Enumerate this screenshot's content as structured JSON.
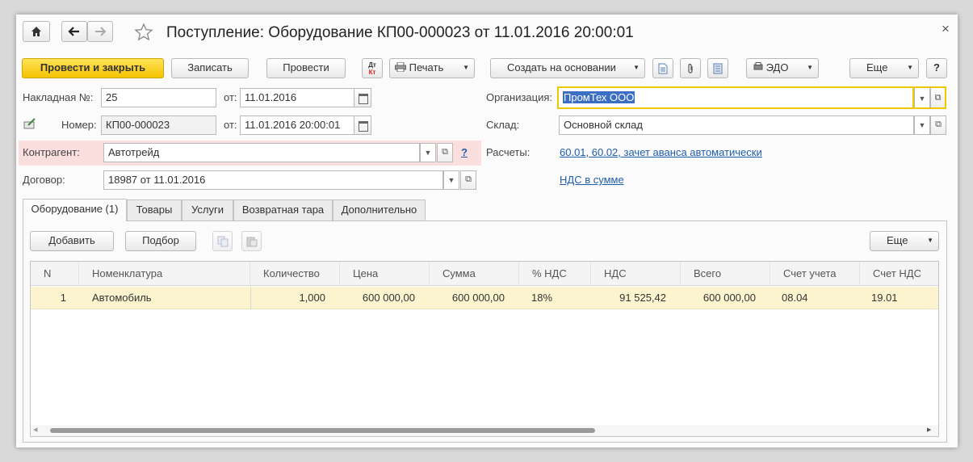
{
  "window": {
    "title": "Поступление: Оборудование КП00-000023 от 11.01.2016 20:00:01",
    "close_glyph": "×"
  },
  "toolbar": {
    "post_close": "Провести и закрыть",
    "save": "Записать",
    "post": "Провести",
    "dtkt_top": "Дт",
    "dtkt_bottom": "Кт",
    "print": "Печать",
    "create_based": "Создать на основании",
    "edo": "ЭДО",
    "more": "Еще",
    "help": "?"
  },
  "header": {
    "invoice_label": "Накладная  №:",
    "invoice_no": "25",
    "from_label1": "от:",
    "invoice_date": "11.01.2016",
    "number_label": "Номер:",
    "number_value": "КП00-000023",
    "from_label2": "от:",
    "number_date": "11.01.2016 20:00:01",
    "counterparty_label": "Контрагент:",
    "counterparty_value": "Автотрейд",
    "counterparty_help": "?",
    "contract_label": "Договор:",
    "contract_value": "18987 от 11.01.2016",
    "org_label": "Организация:",
    "org_value": "ПромТех ООО",
    "warehouse_label": "Склад:",
    "warehouse_value": "Основной склад",
    "settlements_label": "Расчеты:",
    "settlements_link": "60.01, 60.02, зачет аванса автоматически",
    "vat_link": "НДС в сумме"
  },
  "tabs": [
    {
      "label": "Оборудование (1)"
    },
    {
      "label": "Товары"
    },
    {
      "label": "Услуги"
    },
    {
      "label": "Возвратная тара"
    },
    {
      "label": "Дополнительно"
    }
  ],
  "table_toolbar": {
    "add": "Добавить",
    "pick": "Подбор",
    "more": "Еще"
  },
  "table": {
    "columns": [
      "N",
      "Номенклатура",
      "Количество",
      "Цена",
      "Сумма",
      "% НДС",
      "НДС",
      "Всего",
      "Счет учета",
      "Счет НДС"
    ],
    "rows": [
      {
        "n": "1",
        "item": "Автомобиль",
        "qty": "1,000",
        "price": "600 000,00",
        "sum": "600 000,00",
        "vat_rate": "18%",
        "vat": "91 525,42",
        "total": "600 000,00",
        "account": "08.04",
        "vat_account": "19.01"
      }
    ]
  },
  "colors": {
    "accent_yellow": "#f5c400",
    "selected_row": "#fbf4cf",
    "counterparty_highlight": "#fbdede",
    "link": "#1f5da8"
  }
}
